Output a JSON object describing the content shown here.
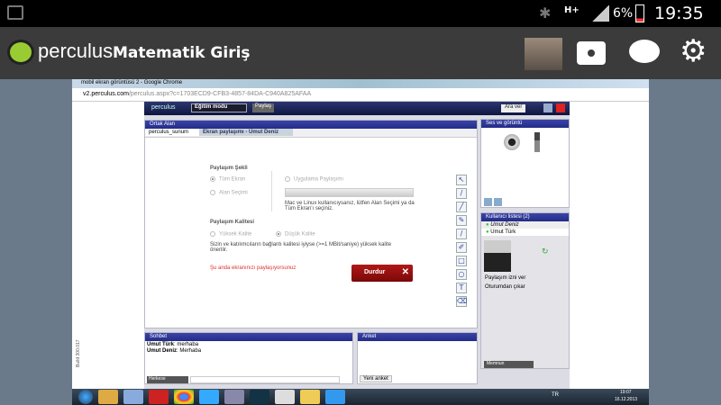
{
  "status_bar": {
    "time": "19:35",
    "battery": "6%",
    "network": "H+"
  },
  "app_bar": {
    "logo": "perculus",
    "title": "Matematik Giriş",
    "icons": [
      "camera-icon",
      "chat-icon",
      "gear-icon"
    ]
  },
  "browser": {
    "window_title": "mobil ekran görüntüsü 2 - Google Chrome",
    "url_host": "v2.perculus.com",
    "url_path": "/perculus.aspx?c=1703ECD9-CFB3-4857-84DA-C940A825AFAA"
  },
  "toolbar": {
    "logo": "perculus",
    "mode": "Eğitim modu",
    "share": "Paylaş",
    "pause": "Ara ver"
  },
  "main": {
    "title": "Ortak Alan",
    "tabs": [
      {
        "label": "perculus_sunum"
      },
      {
        "label": "Ekran paylaşımı - Umut Deniz"
      }
    ],
    "share_mode_title": "Paylaşım Şekli",
    "opt_full": "Tüm Ekran",
    "opt_area": "Alan Seçimi",
    "opt_app": "Uygulama Paylaşımı",
    "mac_note": "Mac ve Linux kullanıcıysanız, lütfen Alan Seçimi ya da Tüm Ekran'ı seçiniz.",
    "quality_title": "Paylaşım Kalitesi",
    "opt_high": "Yüksek Kalite",
    "opt_low": "Düşük Kalite",
    "quality_note": "Sizin ve katılımcıların bağlantı kalitesi iyiyse (>=1 MBit/saniye) yüksek kalite önerilir.",
    "sharing_status": "Şu anda ekranınızı paylaşıyorsunuz",
    "stop_button": "Durdur"
  },
  "av": {
    "title": "Ses ve görüntü"
  },
  "users": {
    "title": "Kullanıcı listesi (2)",
    "list": [
      {
        "name": "Umut Deniz"
      },
      {
        "name": "Umut Türk"
      }
    ],
    "allow_share": "Paylaşım izni ver",
    "remove": "Oturumdan çıkar",
    "status_select": "Memnun"
  },
  "chat": {
    "title": "Sohbet",
    "messages": [
      {
        "user": "Umut Türk",
        "text": "merhaba"
      },
      {
        "user": "Umut Deniz",
        "text": "Merhaba"
      }
    ],
    "recipient": "Herkese"
  },
  "poll": {
    "title": "Anket",
    "new_button": "Yeni anket"
  },
  "build": "Build 300.017",
  "taskbar": {
    "lang": "TR",
    "time": "19:07",
    "date": "16.12.2013"
  },
  "colors": {
    "accent": "#232c86",
    "stop": "#9b0d0d",
    "status_red": "#e03030"
  }
}
